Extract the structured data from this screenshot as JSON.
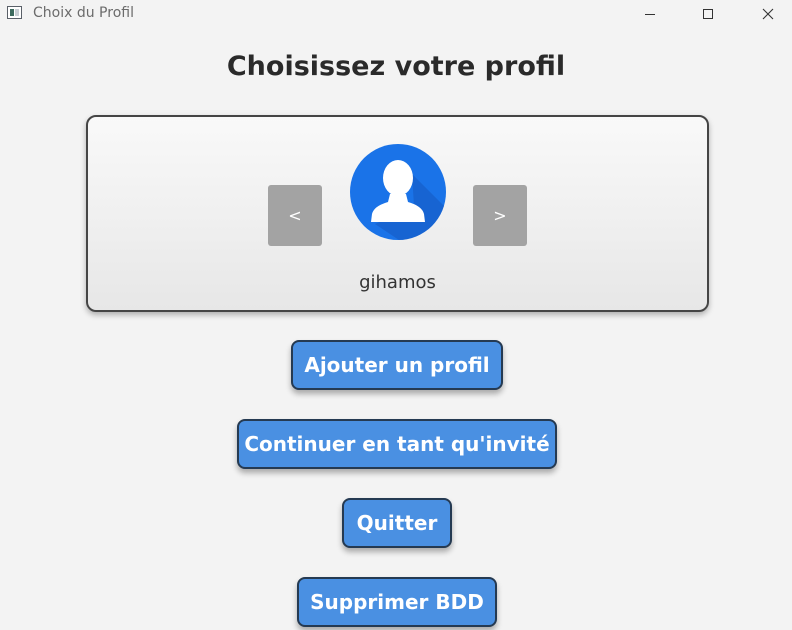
{
  "window": {
    "title": "Choix du Profil"
  },
  "page": {
    "title": "Choisissez votre profil"
  },
  "profile_selector": {
    "prev_label": "<",
    "next_label": ">",
    "username": "gihamos",
    "avatar_icon": "user-avatar-icon"
  },
  "actions": {
    "add_profile": "Ajouter un profil",
    "continue_guest": "Continuer en tant qu'invité",
    "quit": "Quitter",
    "delete_db": "Supprimer BDD"
  },
  "colors": {
    "button_primary": "#4a90e2",
    "button_border": "#253a52",
    "nav_button": "#a3a3a3",
    "avatar_blue": "#1a73e8"
  }
}
